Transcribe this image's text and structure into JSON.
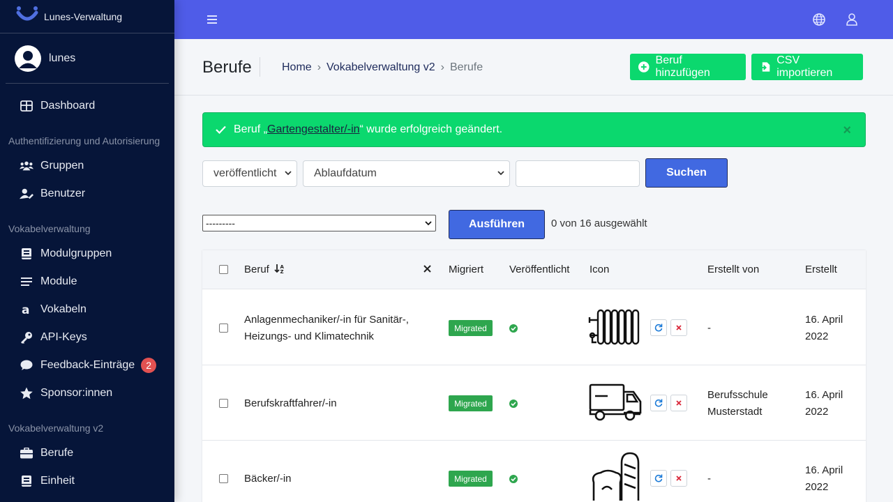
{
  "brand": {
    "name": "Lunes-Verwaltung"
  },
  "user": {
    "name": "lunes"
  },
  "sidebar": {
    "items": [
      {
        "label": "Dashboard",
        "icon": "dashboard-icon"
      },
      {
        "header": "Authentifizierung und Autorisierung"
      },
      {
        "label": "Gruppen",
        "icon": "users-icon"
      },
      {
        "label": "Benutzer",
        "icon": "user-edit-icon"
      },
      {
        "header": "Vokabelverwaltung"
      },
      {
        "label": "Modulgruppen",
        "icon": "book-icon"
      },
      {
        "label": "Module",
        "icon": "list-icon"
      },
      {
        "label": "Vokabeln",
        "icon": "letter-a-icon"
      },
      {
        "label": "API-Keys",
        "icon": "key-icon"
      },
      {
        "label": "Feedback-Einträge",
        "icon": "comment-icon",
        "badge": "2"
      },
      {
        "label": "Sponsor:innen",
        "icon": "star-icon"
      },
      {
        "header": "Vokabelverwaltung v2"
      },
      {
        "label": "Berufe",
        "icon": "briefcase-icon"
      },
      {
        "label": "Einheit",
        "icon": "book-icon"
      }
    ]
  },
  "header": {
    "title": "Berufe",
    "breadcrumb": [
      "Home",
      "Vokabelverwaltung v2",
      "Berufe"
    ],
    "sep": "›",
    "add_button": "Beruf hinzufügen",
    "import_button": "CSV importieren"
  },
  "alert": {
    "prefix": "Beruf „",
    "link": "Gartengestalter/-in",
    "suffix": "“ wurde erfolgreich geändert.",
    "close": "×"
  },
  "filters": {
    "status_value": "veröffentlicht",
    "date_value": "Ablaufdatum",
    "search_value": "",
    "search_button": "Suchen"
  },
  "actions": {
    "select_value": "---------",
    "run_button": "Ausführen",
    "selected_text": "0 von 16 ausgewählt"
  },
  "table": {
    "headers": {
      "beruf": "Beruf",
      "migriert": "Migriert",
      "veroeffentlicht": "Veröffentlicht",
      "icon": "Icon",
      "erstellt_von": "Erstellt von",
      "erstellt": "Erstellt"
    },
    "rows": [
      {
        "beruf_l1": "Anlagenmechaniker/-in für Sanitär-,",
        "beruf_l2": "Heizungs- und Klimatechnik",
        "migriert": "Migrated",
        "icon": "radiator-icon",
        "erstellt_von_l1": "-",
        "erstellt_von_l2": "",
        "erstellt_l1": "16. April",
        "erstellt_l2": "2022"
      },
      {
        "beruf_l1": "Berufskraftfahrer/-in",
        "beruf_l2": "",
        "migriert": "Migrated",
        "icon": "truck-icon",
        "erstellt_von_l1": "Berufsschule",
        "erstellt_von_l2": "Musterstadt",
        "erstellt_l1": "16. April",
        "erstellt_l2": "2022"
      },
      {
        "beruf_l1": "Bäcker/-in",
        "beruf_l2": "",
        "migriert": "Migrated",
        "icon": "bread-icon",
        "erstellt_von_l1": "-",
        "erstellt_von_l2": "",
        "erstellt_l1": "16. April",
        "erstellt_l2": "2022"
      }
    ]
  },
  "colors": {
    "sidebar": "#061539",
    "topbar": "#4f5ce8",
    "success": "#0bd86e",
    "primary": "#4169e1",
    "badge": "#e25151"
  }
}
